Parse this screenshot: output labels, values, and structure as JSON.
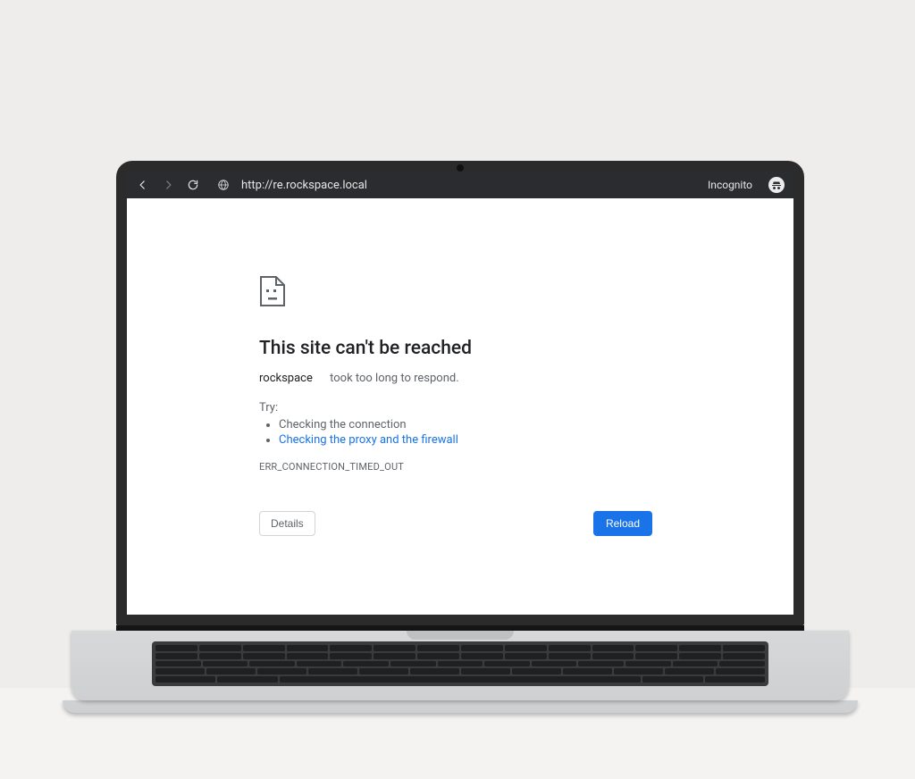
{
  "toolbar": {
    "url": "http://re.rockspace.local",
    "incognito_label": "Incognito"
  },
  "error": {
    "title": "This site can't be reached",
    "host": "rockspace",
    "subtitle_rest": "took too long to respond.",
    "try_label": "Try:",
    "tips": {
      "connection": "Checking the connection",
      "proxy": "Checking the proxy and the firewall"
    },
    "code": "ERR_CONNECTION_TIMED_OUT",
    "details_label": "Details",
    "reload_label": "Reload"
  }
}
